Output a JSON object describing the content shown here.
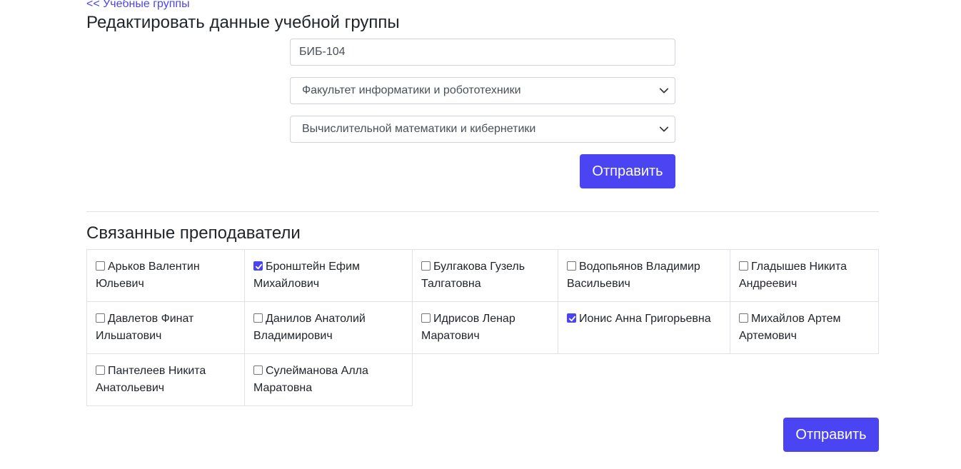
{
  "nav": {
    "back_link": "<< Учебные группы"
  },
  "page_title": "Редактировать данные учебной группы",
  "form": {
    "group_name_value": "БИБ-104",
    "faculty_selected": "Факультет информатики и робототехники",
    "department_selected": "Вычислительной математики и кибернетики",
    "submit_label": "Отправить"
  },
  "teachers_section": {
    "title": "Связанные преподаватели",
    "teachers": [
      {
        "name": "Арьков Валентин Юльевич",
        "checked": false
      },
      {
        "name": "Бронштейн Ефим Михайлович",
        "checked": true
      },
      {
        "name": "Булгакова Гузель Талгатовна",
        "checked": false
      },
      {
        "name": "Водопьянов Владимир Васильевич",
        "checked": false
      },
      {
        "name": "Гладышев Никита Андреевич",
        "checked": false
      },
      {
        "name": "Давлетов Финат Ильшатович",
        "checked": false
      },
      {
        "name": "Данилов Анатолий Владимирович",
        "checked": false
      },
      {
        "name": "Идрисов Ленар Маратович",
        "checked": false
      },
      {
        "name": "Ионис Анна Григорьевна",
        "checked": true
      },
      {
        "name": "Михайлов Артем Артемович",
        "checked": false
      },
      {
        "name": "Пантелеев Никита Анатольевич",
        "checked": false
      },
      {
        "name": "Сулейманова Алла Маратовна",
        "checked": false
      }
    ],
    "submit_label": "Отправить"
  },
  "colors": {
    "accent": "#4a44f2",
    "border": "#dee2e6",
    "text": "#212529"
  }
}
